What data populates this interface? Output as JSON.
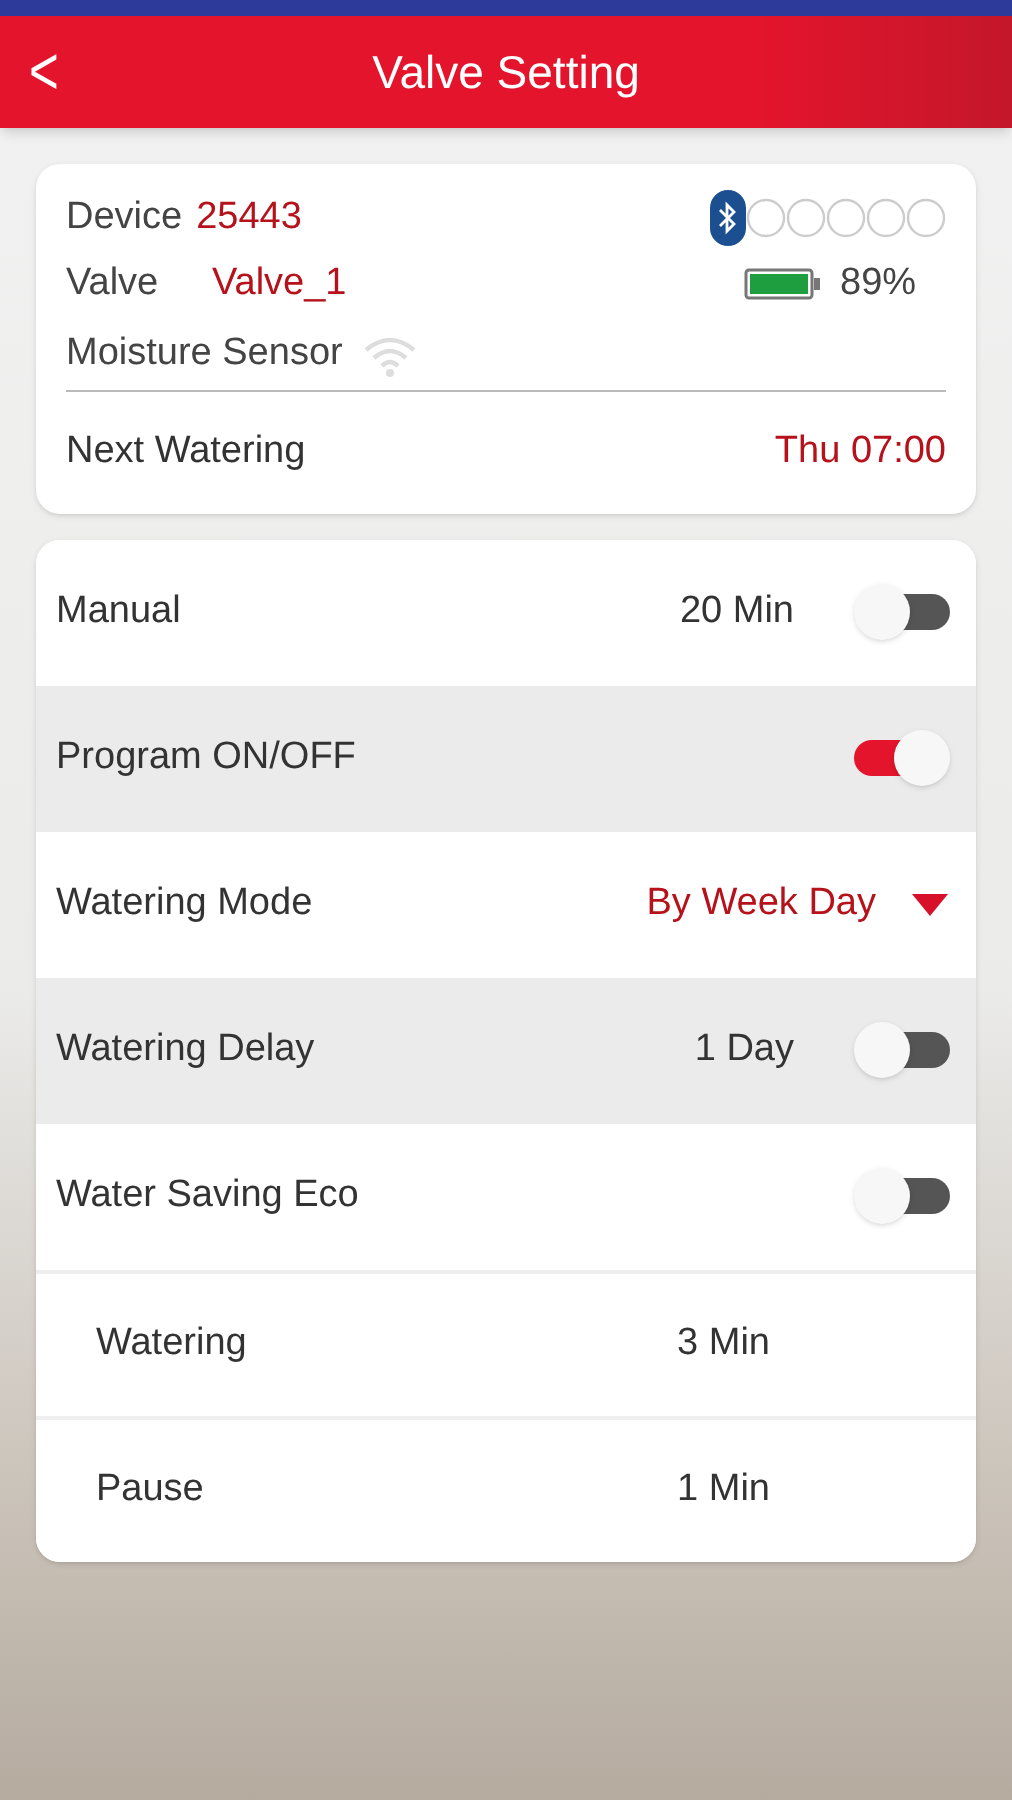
{
  "header": {
    "back": "<",
    "title": "Valve Setting"
  },
  "device": {
    "device_label": "Device",
    "device_value": "25443",
    "valve_label": "Valve",
    "valve_value": "Valve_1",
    "battery": "89%",
    "sensor_label": "Moisture Sensor",
    "next_label": "Next Watering",
    "next_value": "Thu 07:00"
  },
  "rows": [
    {
      "kind": "toggle",
      "label": "Manual",
      "value": "20 Min",
      "on": false,
      "shaded": false
    },
    {
      "kind": "toggle",
      "label": "Program ON/OFF",
      "on": true,
      "shaded": true
    },
    {
      "kind": "dropdown",
      "label": "Watering Mode",
      "value": "By Week Day",
      "shaded": false
    },
    {
      "kind": "toggle",
      "label": "Watering Delay",
      "value": "1 Day",
      "on": false,
      "shaded": true
    },
    {
      "kind": "toggle",
      "label": "Water Saving Eco",
      "on": false,
      "shaded": false
    },
    {
      "kind": "sub",
      "label": "Watering",
      "value": "3 Min",
      "shaded": false
    },
    {
      "kind": "sub",
      "label": "Pause",
      "value": "1 Min",
      "shaded": false
    }
  ]
}
